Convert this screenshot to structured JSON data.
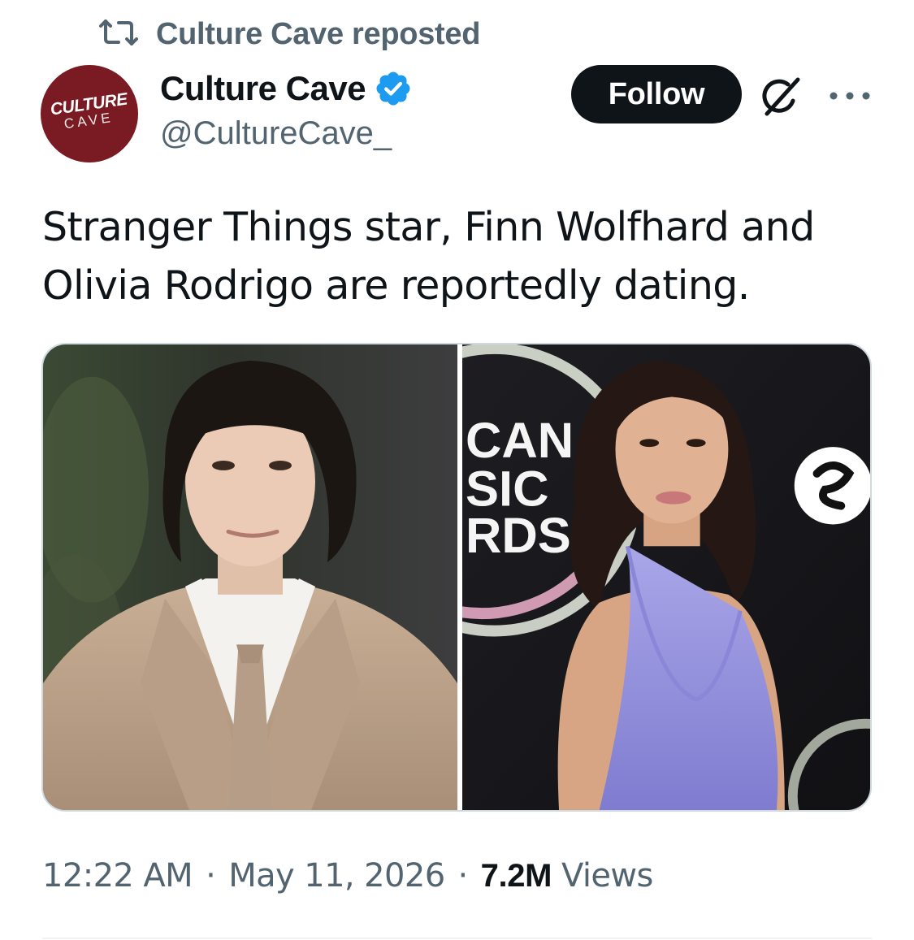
{
  "repost": {
    "icon": "repost-icon",
    "text": "Culture Cave reposted"
  },
  "author": {
    "avatar_logo_top": "CULTURE",
    "avatar_logo_bottom": "CAVE",
    "display_name": "Culture Cave",
    "verified_icon": "verified-badge-icon",
    "handle": "@CultureCave_"
  },
  "actions": {
    "follow_label": "Follow",
    "grok_icon": "grok-icon",
    "more_icon": "more-icon"
  },
  "tweet": {
    "text": "Stranger Things star, Finn Wolfhard and Olivia Rodrigo are reportedly dating."
  },
  "media": {
    "left_photo": "photo-man-beige-suit",
    "right_photo": "photo-woman-blue-top",
    "backdrop_text": [
      "CAN",
      "SIC",
      "RDS"
    ]
  },
  "meta": {
    "time": "12:22 AM",
    "separator": "·",
    "date": "May 11, 2026",
    "views_count": "7.2M",
    "views_label": "Views"
  },
  "colors": {
    "text_primary": "#0f1419",
    "text_secondary": "#536471",
    "verified_blue": "#1d9bf0",
    "avatar_bg": "#7a1a22",
    "border": "#cfd9de"
  }
}
